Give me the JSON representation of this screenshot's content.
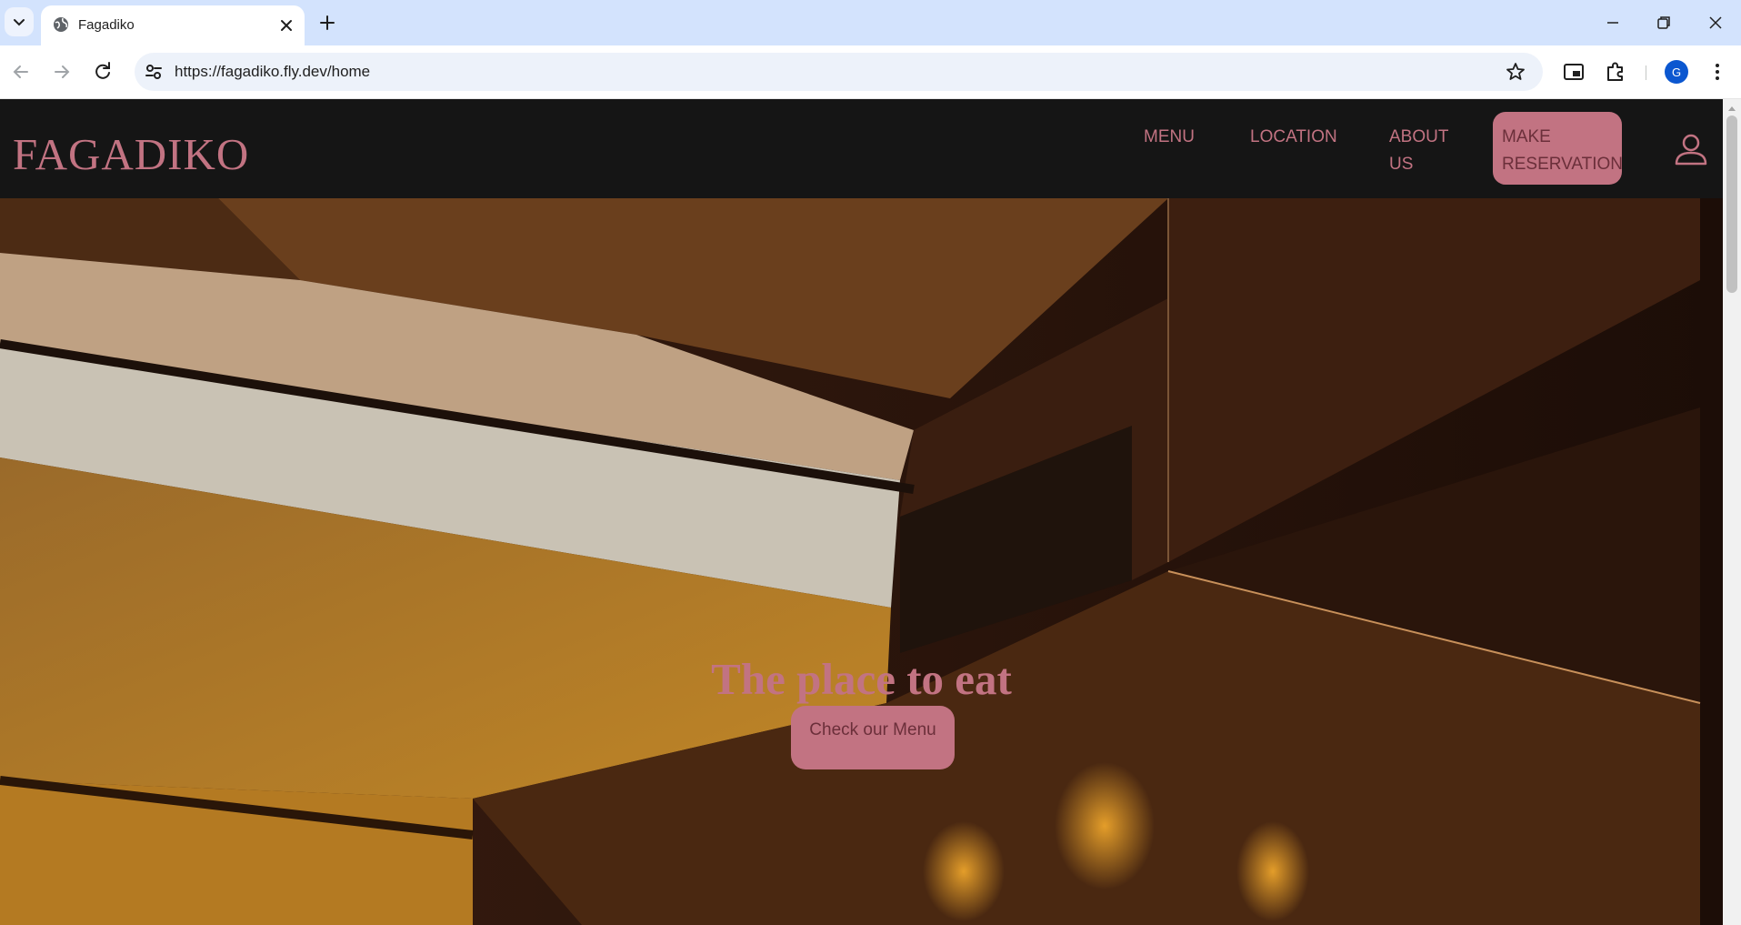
{
  "browser": {
    "tab": {
      "title": "Fagadiko"
    },
    "address_bar": {
      "url": "https://fagadiko.fly.dev/home"
    },
    "profile_initial": "G"
  },
  "site": {
    "brand": "FAGADIKO",
    "nav": {
      "menu": "MENU",
      "location": "LOCATION",
      "about_line1": "ABOUT",
      "about_line2": "US",
      "reserve_line1": "MAKE",
      "reserve_line2": "RESERVATION"
    },
    "hero": {
      "title": "The place to eat",
      "cta": "Check our Menu"
    }
  },
  "colors": {
    "accent": "#c27382",
    "accent_text": "#6b2f3a",
    "header_bg": "#151515",
    "tabstrip_bg": "#d3e3fd",
    "omnibox_bg": "#edf2fa"
  }
}
